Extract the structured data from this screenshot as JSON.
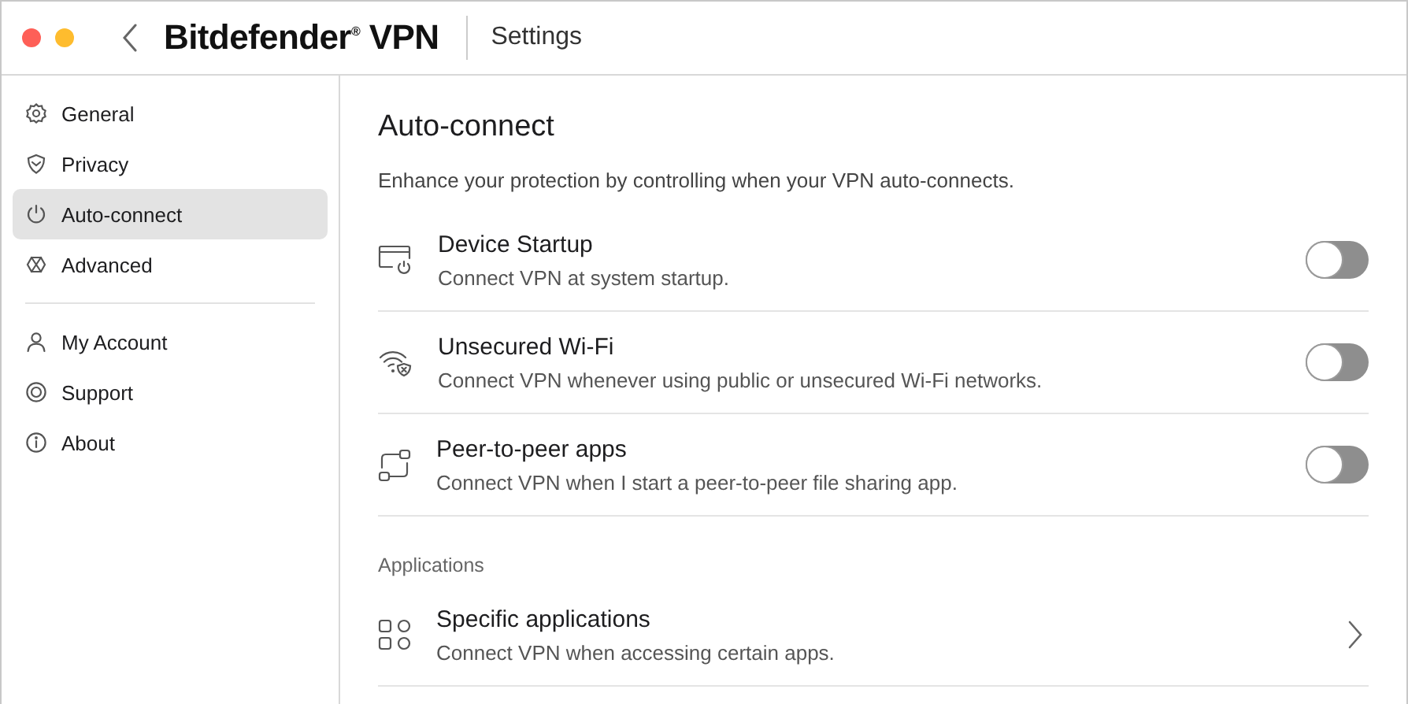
{
  "window": {
    "app_name": "Bitdefender$^{®}$ VPN",
    "title": "Settings"
  },
  "sidebar": {
    "groups": [
      [
        {
          "label": "General",
          "selected": false
        },
        {
          "label": "Privacy",
          "selected": false
        },
        {
          "label": "Auto-connect",
          "selected": true
        },
        {
          "label": "Advanced",
          "selected": false
        }
      ],
      [
        {
          "label": "My Account",
          "selected": false
        },
        {
          "label": "Support",
          "selected": false
        },
        {
          "label": "About",
          "selected": false
        }
      ]
    ]
  },
  "page": {
    "heading": "Auto-connect",
    "description": "Enhance your protection by controlling when your VPN auto-connects.",
    "sections": [
      {
        "rows": [
          {
            "kind": "toggle",
            "title": "Device Startup",
            "description": "Connect VPN at system startup.",
            "on": false
          },
          {
            "kind": "toggle",
            "title": "Unsecured Wi-Fi",
            "description": "Connect VPN whenever using public or unsecured Wi-Fi networks.",
            "on": false
          },
          {
            "kind": "toggle",
            "title": "Peer-to-peer apps",
            "description": "Connect VPN when I start a peer-to-peer file sharing app.",
            "on": false
          }
        ]
      },
      {
        "label": "Applications",
        "rows": [
          {
            "kind": "link",
            "title": "Specific applications",
            "description": "Connect VPN when accessing certain apps."
          }
        ]
      }
    ]
  }
}
